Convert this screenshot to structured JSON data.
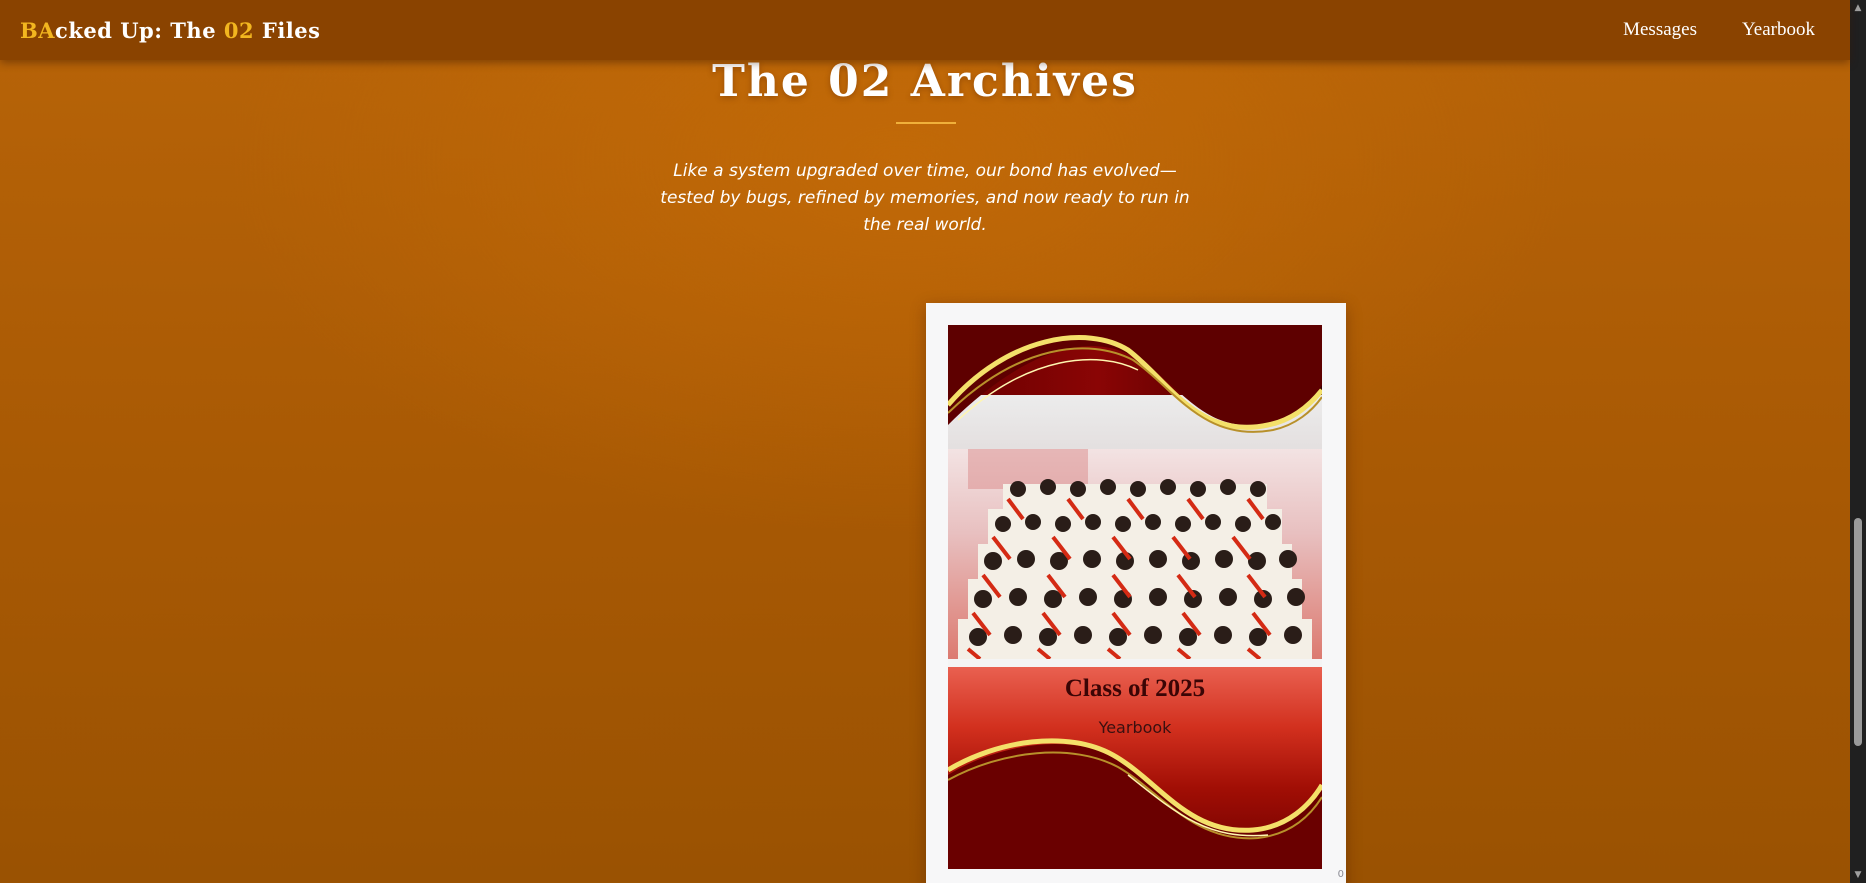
{
  "nav": {
    "brand": {
      "part1": "BA",
      "part2": "cked Up: The ",
      "part3": "02",
      "part4": " Files"
    },
    "links": [
      {
        "label": "Messages"
      },
      {
        "label": "Yearbook"
      }
    ]
  },
  "hero": {
    "title": "The 02 Archives",
    "tagline": "Like a system upgraded over time, our bond has evolved—tested by bugs, refined by memories, and now ready to run in the real world."
  },
  "yearbook": {
    "class_title": "Class of 2025",
    "subtitle": "Yearbook",
    "page_number": "0"
  },
  "colors": {
    "accent": "#f2b61f",
    "navbar": "#8a4300",
    "background": "#b06006"
  }
}
